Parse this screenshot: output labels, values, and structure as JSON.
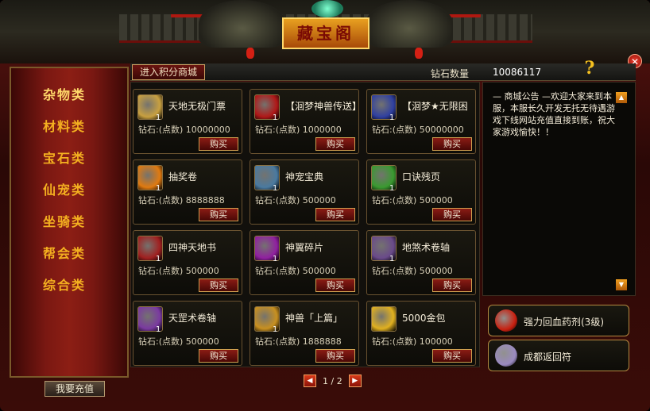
{
  "header": {
    "title": "藏宝阁",
    "points_shop_label": "进入积分商城",
    "diamond_label": "钻石数量",
    "diamond_value": "10086117",
    "help_glyph": "?",
    "close_glyph": "✕"
  },
  "sidebar": {
    "tabs": [
      {
        "label": "杂物类"
      },
      {
        "label": "材料类"
      },
      {
        "label": "宝石类"
      },
      {
        "label": "仙宠类"
      },
      {
        "label": "坐骑类"
      },
      {
        "label": "帮会类"
      },
      {
        "label": "综合类"
      }
    ],
    "active_index": 0,
    "recharge_label": "我要充值"
  },
  "items": [
    {
      "name": "天地无极门票",
      "qty": "1",
      "price": "钻石:(点数) 10000000",
      "buy": "购买",
      "icon": "ticket-icon",
      "color": "#c8a040"
    },
    {
      "name": "【洄梦神兽传送】",
      "qty": "1",
      "price": "钻石:(点数) 1000000",
      "buy": "购买",
      "icon": "beast-teleport-icon",
      "color": "#b01818"
    },
    {
      "name": "【洄梦★无限困",
      "qty": "1",
      "price": "钻石:(点数) 50000000",
      "buy": "购买",
      "icon": "trap-icon",
      "color": "#3040a0"
    },
    {
      "name": "抽奖卷",
      "qty": "1",
      "price": "钻石:(点数) 8888888",
      "buy": "购买",
      "icon": "lottery-icon",
      "color": "#e07a10"
    },
    {
      "name": "神宠宝典",
      "qty": "1",
      "price": "钻石:(点数) 500000",
      "buy": "购买",
      "icon": "pet-book-icon",
      "color": "#4a7aa0"
    },
    {
      "name": "口诀残页",
      "qty": "1",
      "price": "钻石:(点数) 500000",
      "buy": "购买",
      "icon": "scroll-page-icon",
      "color": "#3a9a30"
    },
    {
      "name": "四神天地书",
      "qty": "1",
      "price": "钻石:(点数) 500000",
      "buy": "购买",
      "icon": "four-gods-book-icon",
      "color": "#a02020"
    },
    {
      "name": "神翼碎片",
      "qty": "1",
      "price": "钻石:(点数) 500000",
      "buy": "购买",
      "icon": "wing-shard-icon",
      "color": "#9020a0"
    },
    {
      "name": "地煞术卷轴",
      "qty": "1",
      "price": "钻石:(点数) 500000",
      "buy": "购买",
      "icon": "earth-scroll-icon",
      "color": "#6a4a8a"
    },
    {
      "name": "天罡术卷轴",
      "qty": "1",
      "price": "钻石:(点数) 500000",
      "buy": "购买",
      "icon": "heaven-scroll-icon",
      "color": "#7a3aa0"
    },
    {
      "name": "神兽「上篇」",
      "qty": "1",
      "price": "钻石:(点数) 1888888",
      "buy": "购买",
      "icon": "beast-book-icon",
      "color": "#c89020"
    },
    {
      "name": "5000金包",
      "qty": "",
      "price": "钻石:(点数) 100000",
      "buy": "购买",
      "icon": "gold-bag-icon",
      "color": "#e0b020"
    }
  ],
  "pager": {
    "prev_glyph": "◀",
    "next_glyph": "▶",
    "text": "1 / 2"
  },
  "announcement": {
    "text": "— 商城公告 —欢迎大家来到本服，本服长久开发无托无待遇游戏下线网站充值直接到账，祝大家游戏愉快！！",
    "scroll_up_glyph": "▲",
    "scroll_down_glyph": "▼"
  },
  "quick_items": [
    {
      "name": "强力回血药剂(3级)",
      "icon": "health-potion-icon",
      "color": "#c82010"
    },
    {
      "name": "成都返回符",
      "icon": "return-talisman-icon",
      "color": "#9a8ac0"
    }
  ]
}
